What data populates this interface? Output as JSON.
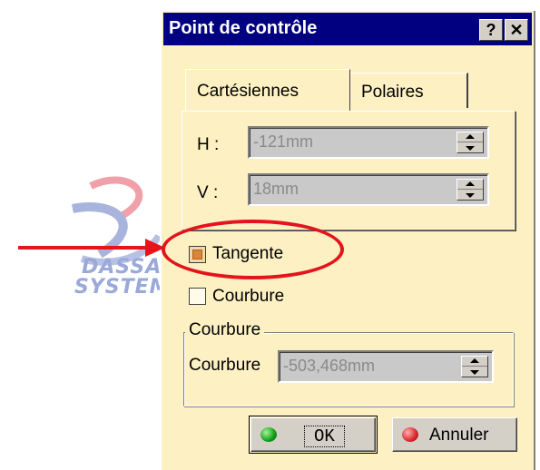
{
  "watermark": {
    "line1": "DASSAULT",
    "line2": "SYSTEMES"
  },
  "dialog": {
    "title": "Point de contrôle",
    "help_button": "?",
    "close_button": "✕",
    "tabs": [
      "Cartésiennes",
      "Polaires"
    ],
    "fields": [
      {
        "label": "H :",
        "value": "-121mm"
      },
      {
        "label": "V :",
        "value": "18mm"
      }
    ],
    "tangente": {
      "label": "Tangente",
      "checked": true
    },
    "courbure_check": {
      "label": "Courbure",
      "checked": false
    },
    "group": {
      "title": "Courbure",
      "field_label": "Courbure",
      "field_value": "-503,468mm"
    },
    "buttons": {
      "ok": "OK",
      "cancel": "Annuler"
    }
  },
  "annotation": {
    "arrow_color": "#e8141b",
    "circle_color": "#e3141e"
  }
}
